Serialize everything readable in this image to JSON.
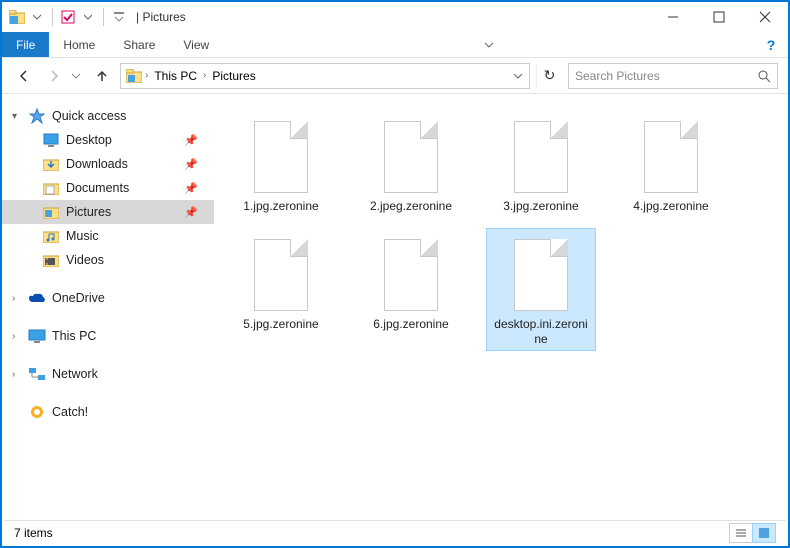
{
  "titlebar": {
    "title": "Pictures"
  },
  "ribbon": {
    "file": "File",
    "home": "Home",
    "share": "Share",
    "view": "View"
  },
  "breadcrumb": {
    "root": "This PC",
    "current": "Pictures"
  },
  "search": {
    "placeholder": "Search Pictures"
  },
  "sidebar": {
    "quick_access": "Quick access",
    "items": [
      {
        "label": "Desktop"
      },
      {
        "label": "Downloads"
      },
      {
        "label": "Documents"
      },
      {
        "label": "Pictures"
      },
      {
        "label": "Music"
      },
      {
        "label": "Videos"
      }
    ],
    "onedrive": "OneDrive",
    "thispc": "This PC",
    "network": "Network",
    "catch": "Catch!"
  },
  "files": [
    {
      "name": "1.jpg.zeronine"
    },
    {
      "name": "2.jpeg.zeronine"
    },
    {
      "name": "3.jpg.zeronine"
    },
    {
      "name": "4.jpg.zeronine"
    },
    {
      "name": "5.jpg.zeronine"
    },
    {
      "name": "6.jpg.zeronine"
    },
    {
      "name": "desktop.ini.zeronine",
      "selected": true
    }
  ],
  "status": {
    "text": "7 items"
  }
}
